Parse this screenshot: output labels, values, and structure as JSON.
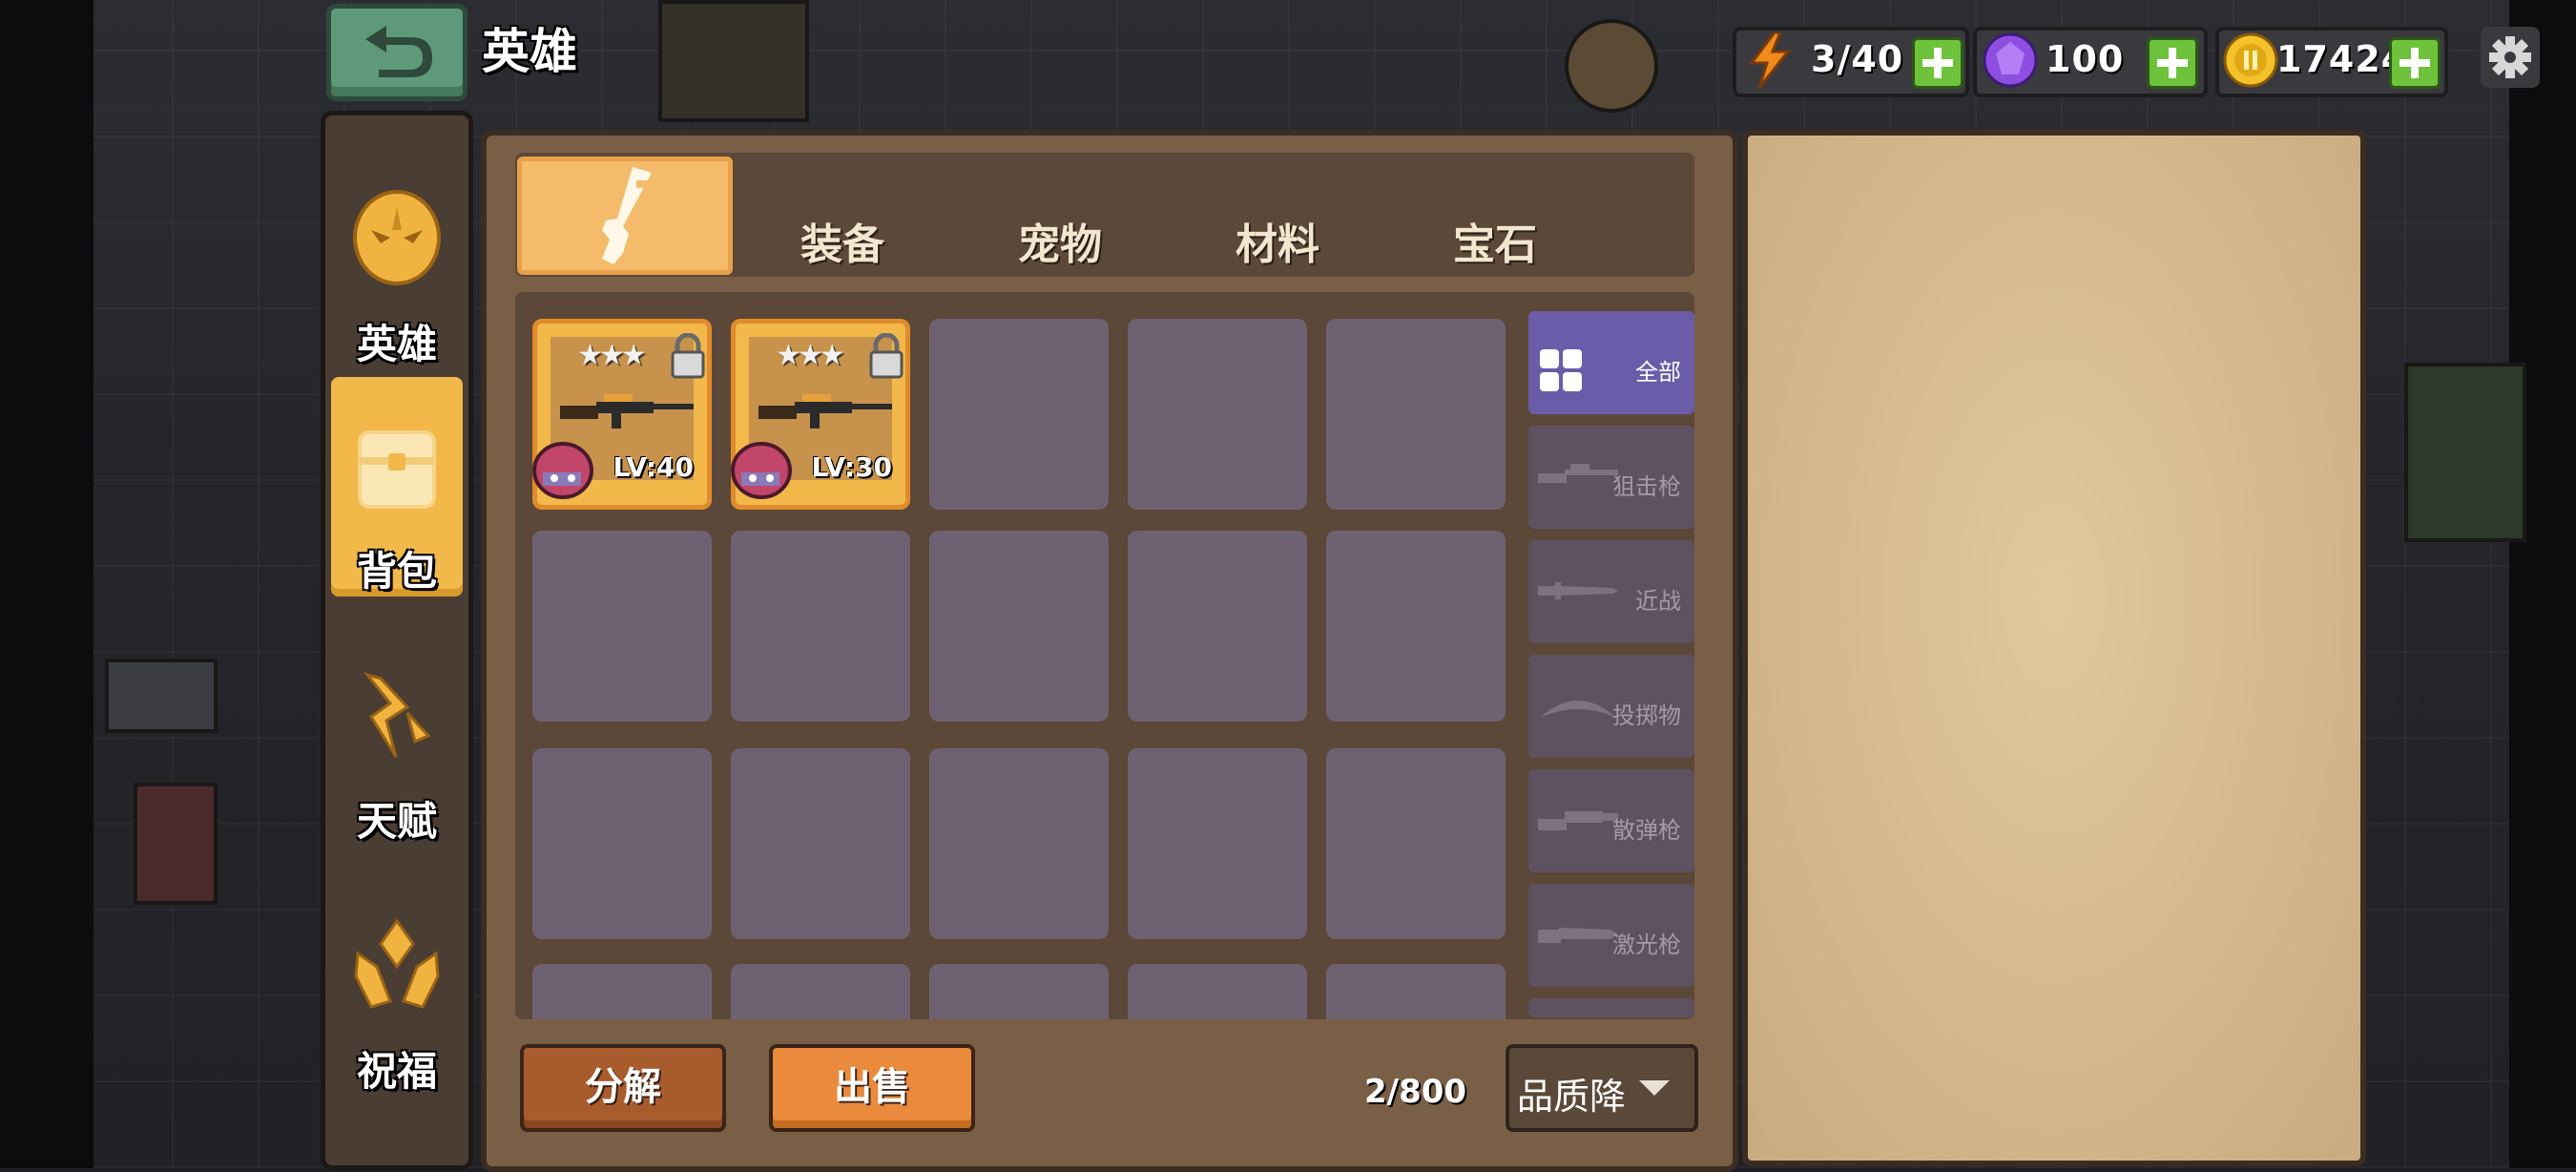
{
  "header": {
    "title": "英雄"
  },
  "currencies": {
    "energy": "3/40",
    "gems": "100",
    "coins": "17424"
  },
  "nav": {
    "items": [
      {
        "label": "英雄",
        "active": false
      },
      {
        "label": "背包",
        "active": true
      },
      {
        "label": "天赋",
        "active": false
      },
      {
        "label": "祝福",
        "active": false
      }
    ]
  },
  "tabs": [
    {
      "label": "",
      "icon": "weapon-icon",
      "active": true
    },
    {
      "label": "装备",
      "active": false
    },
    {
      "label": "宠物",
      "active": false
    },
    {
      "label": "材料",
      "active": false
    },
    {
      "label": "宝石",
      "active": false
    }
  ],
  "items": [
    {
      "level": "LV:40",
      "stars": 3,
      "locked": true
    },
    {
      "level": "LV:30",
      "stars": 3,
      "locked": true
    }
  ],
  "filters": [
    {
      "label": "全部",
      "icon": "grid-icon",
      "active": true
    },
    {
      "label": "狙击枪",
      "icon": "sniper-icon",
      "active": false
    },
    {
      "label": "近战",
      "icon": "melee-icon",
      "active": false
    },
    {
      "label": "投掷物",
      "icon": "throwable-icon",
      "active": false
    },
    {
      "label": "散弹枪",
      "icon": "shotgun-icon",
      "active": false
    },
    {
      "label": "激光枪",
      "icon": "laser-gun-icon",
      "active": false
    }
  ],
  "bottom": {
    "decompose_label": "分解",
    "sell_label": "出售",
    "capacity": "2/800",
    "sort_label": "品质降"
  },
  "colors": {
    "active_nav": "#f2b84a",
    "active_filter": "#6a5ca8",
    "plus_button": "#6fc23b",
    "panel": "#7a5f47"
  }
}
